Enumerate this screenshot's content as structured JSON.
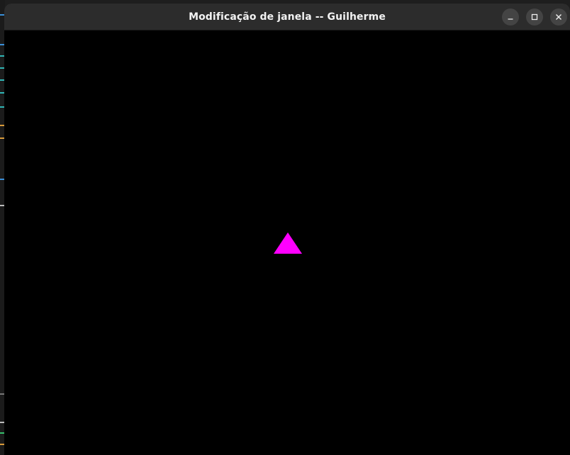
{
  "window": {
    "title": "Modificação de janela -- Guilherme",
    "controls": {
      "minimize_icon": "minimize-icon",
      "maximize_icon": "maximize-icon",
      "close_icon": "close-icon"
    }
  },
  "canvas": {
    "background": "#000000",
    "triangle_color": "#ff00ff"
  },
  "colors": {
    "titlebar": "#2c2c2c",
    "title_text": "#f2f2f2",
    "control_button": "#444444"
  }
}
